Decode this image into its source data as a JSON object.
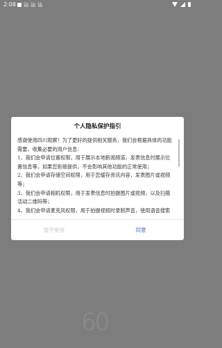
{
  "status_bar": {
    "time": "2:08",
    "left_icons": [
      "square-notification-icon",
      "sn-icon",
      "sn-icon",
      "sn-icon"
    ],
    "left_icon_texts": [
      "汕",
      "汕",
      "汕"
    ],
    "right_icons": [
      "wifi-icon",
      "signal-icon",
      "battery-icon"
    ]
  },
  "dialog": {
    "title": "个人隐私保护指引",
    "paragraphs": [
      "感谢使用四川观察！为了更好的提供相关服务，我们会根据具体的功能需要，收集必要的用户信息：",
      "1、我们会申请位置权限，用于展示本地新闻频道，发表信息时展示位置信息等，如果您拒绝提供，不会影响其他功能的正常使用；",
      "2、我们会申请存储空间权限，用于您缓存资讯内容，发表图片或视频等；",
      "3、我们会申请相机权限，用于发表信息时拍摄图片或视频，以及扫描活动二维码等；",
      "4、我们会申请麦克风权限，用于拍摄视频时录制声音，使用语音搜索"
    ],
    "decline_label": "暂不使用",
    "agree_label": "同意"
  },
  "watermark": {
    "text": "60"
  },
  "colors": {
    "backdrop": "#7d7d7d",
    "dialog_bg": "#ffffff",
    "agree_text": "#4a6fc6",
    "decline_text": "#c2c7cf"
  }
}
